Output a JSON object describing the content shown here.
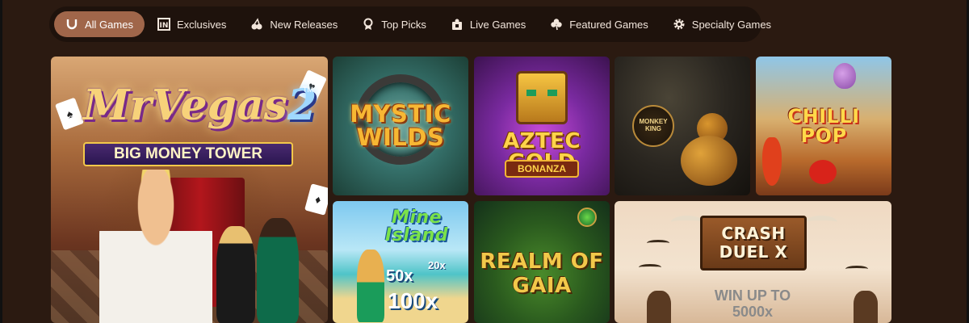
{
  "nav": {
    "tabs": [
      {
        "label": "All Games",
        "icon": "horseshoe-icon",
        "active": true
      },
      {
        "label": "Exclusives",
        "icon": "exclusive-badge-icon",
        "active": false
      },
      {
        "label": "New Releases",
        "icon": "cherries-icon",
        "active": false
      },
      {
        "label": "Top Picks",
        "icon": "award-ribbon-icon",
        "active": false
      },
      {
        "label": "Live Games",
        "icon": "live-dealer-icon",
        "active": false
      },
      {
        "label": "Featured Games",
        "icon": "clover-icon",
        "active": false
      },
      {
        "label": "Specialty Games",
        "icon": "gear-icon",
        "active": false
      }
    ]
  },
  "games": {
    "vegas": {
      "logo_main": "MrVegas",
      "logo_num": "2",
      "logo_sub": "BIG MONEY TOWER",
      "tm": "TM"
    },
    "mystic": {
      "line1": "MYSTIC",
      "line2": "WILDS"
    },
    "aztec": {
      "title": "AZTEC GOLD",
      "sub": "BONANZA"
    },
    "monkey": {
      "line1": "MONKEY",
      "line2": "KING"
    },
    "chilli": {
      "line1": "CHILLI",
      "line2": "POP"
    },
    "mine": {
      "title": "Mine Island",
      "m20": "20x",
      "m50": "50x",
      "m100": "100x"
    },
    "gaia": {
      "line1": "REALM OF",
      "line2": "GAIA"
    },
    "crash": {
      "line1": "CRASH",
      "line2": "DUEL X",
      "win1": "WIN UP TO",
      "win2": "5000x"
    }
  },
  "colors": {
    "background": "#2b1a11",
    "nav_bg": "#1e120c",
    "active_tab": "#a0664a",
    "tab_text": "#f2e6dc"
  }
}
